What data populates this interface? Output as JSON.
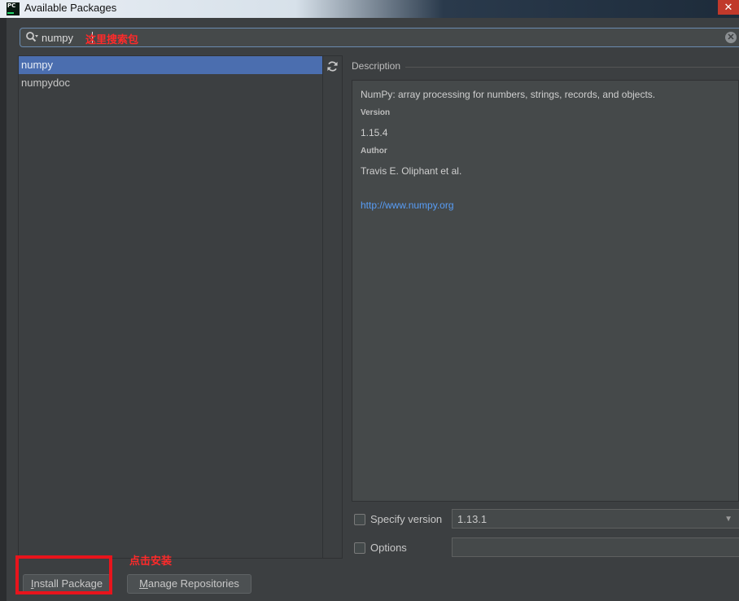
{
  "window": {
    "title": "Available Packages",
    "app_icon_text": "PC",
    "close_glyph": "✕"
  },
  "search": {
    "value": "numpy",
    "annotation": "这里搜索包",
    "clear_glyph": "✕"
  },
  "packages": [
    {
      "name": "numpy",
      "selected": true
    },
    {
      "name": "numpydoc",
      "selected": false
    }
  ],
  "description": {
    "label": "Description",
    "summary": "NumPy: array processing for numbers, strings, records, and objects.",
    "version_label": "Version",
    "version": "1.15.4",
    "author_label": "Author",
    "author": "Travis E. Oliphant et al.",
    "url": "http://www.numpy.org"
  },
  "options": {
    "specify_version_label": "Specify version",
    "specify_version_checked": false,
    "version_value": "1.13.1",
    "options_label": "Options",
    "options_checked": false,
    "options_value": ""
  },
  "buttons": {
    "install": "Install Package",
    "install_mnemonic": "I",
    "install_rest": "nstall Package",
    "manage": "Manage Repositories",
    "manage_mnemonic": "M",
    "manage_rest": "anage Repositories"
  },
  "annotation_install": "点击安装",
  "icons": {
    "search": "search-icon",
    "refresh": "refresh-icon",
    "clear": "clear-icon",
    "dropdown": "chevron-down-icon"
  },
  "colors": {
    "selection": "#4b6eaf",
    "annotation": "#ff2a2a",
    "link": "#589df6",
    "background": "#3c3f41"
  }
}
